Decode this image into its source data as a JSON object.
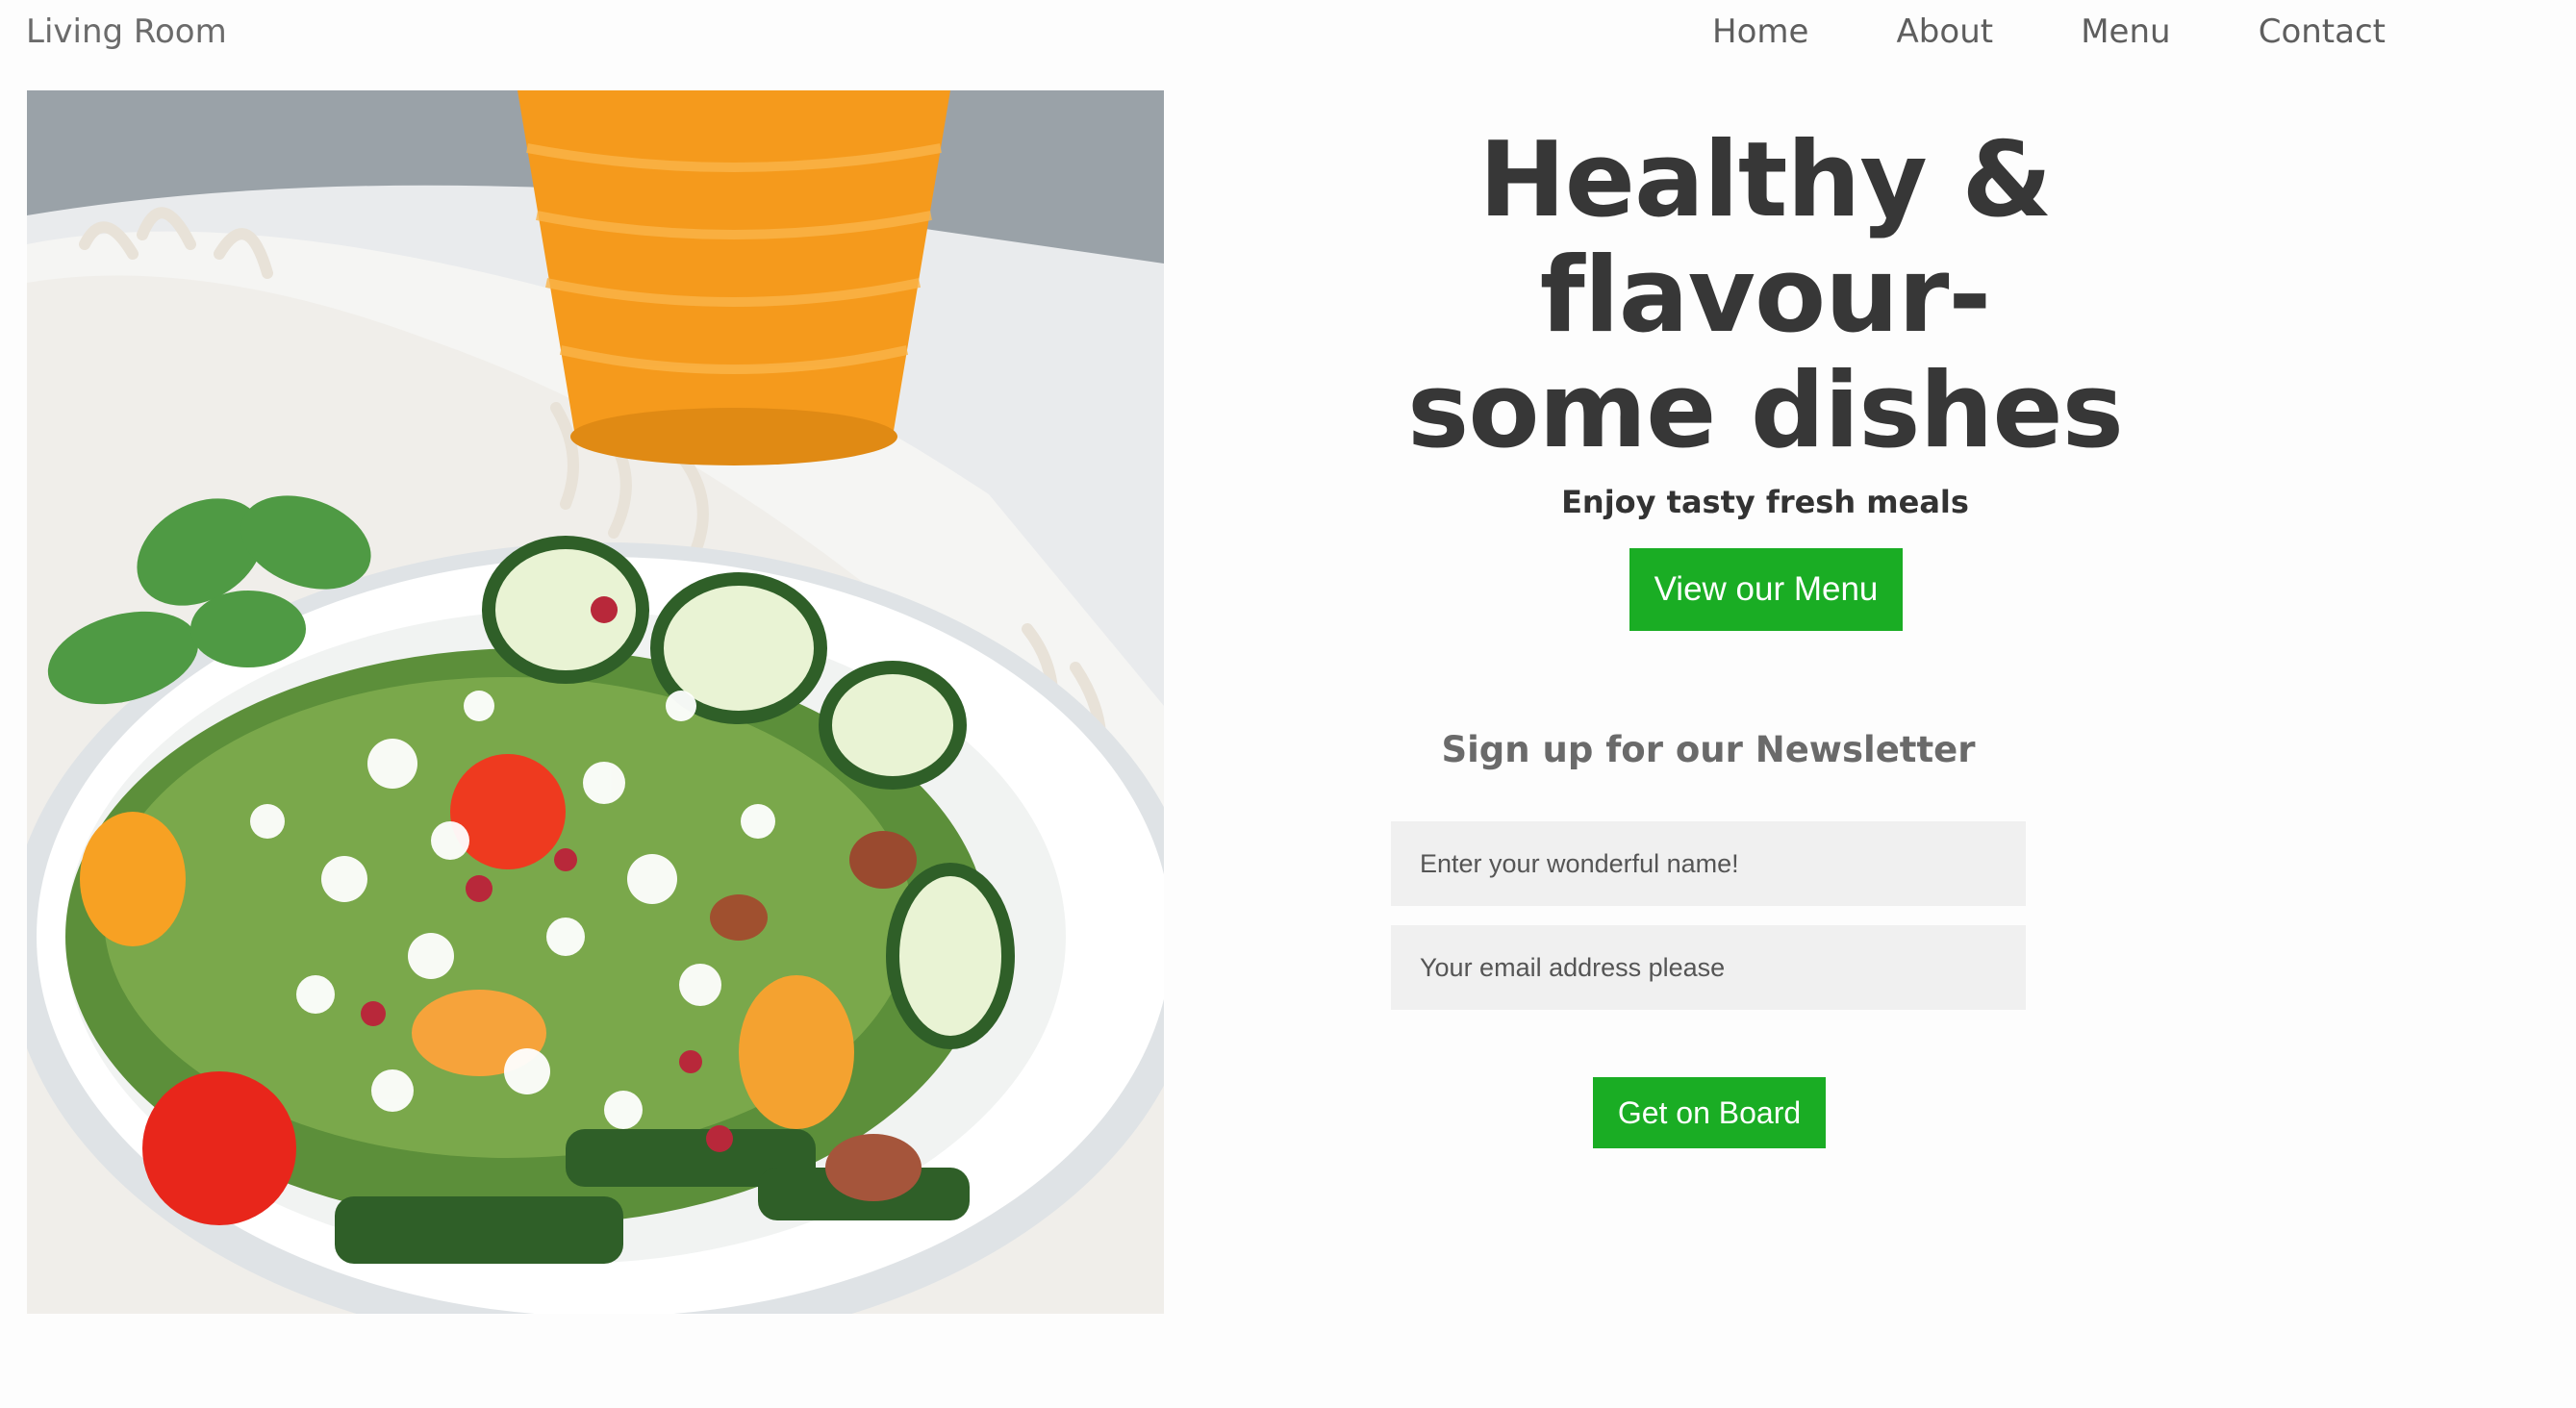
{
  "brand": {
    "name": "Living Room"
  },
  "nav": {
    "items": [
      {
        "label": "Home"
      },
      {
        "label": "About"
      },
      {
        "label": "Menu"
      },
      {
        "label": "Contact"
      }
    ]
  },
  "hero": {
    "title_lines": [
      "Healthy &",
      "flavour-",
      "some dishes"
    ],
    "subtitle": "Enjoy tasty fresh meals",
    "cta_label": "View our Menu"
  },
  "newsletter": {
    "title": "Sign up for our Newsletter",
    "name_placeholder": "Enter your wonderful name!",
    "email_placeholder": "Your email address please",
    "submit_label": "Get on Board"
  },
  "colors": {
    "accent_green": "#1aad24",
    "heading": "#373737",
    "field_bg": "#f0f0f0"
  }
}
